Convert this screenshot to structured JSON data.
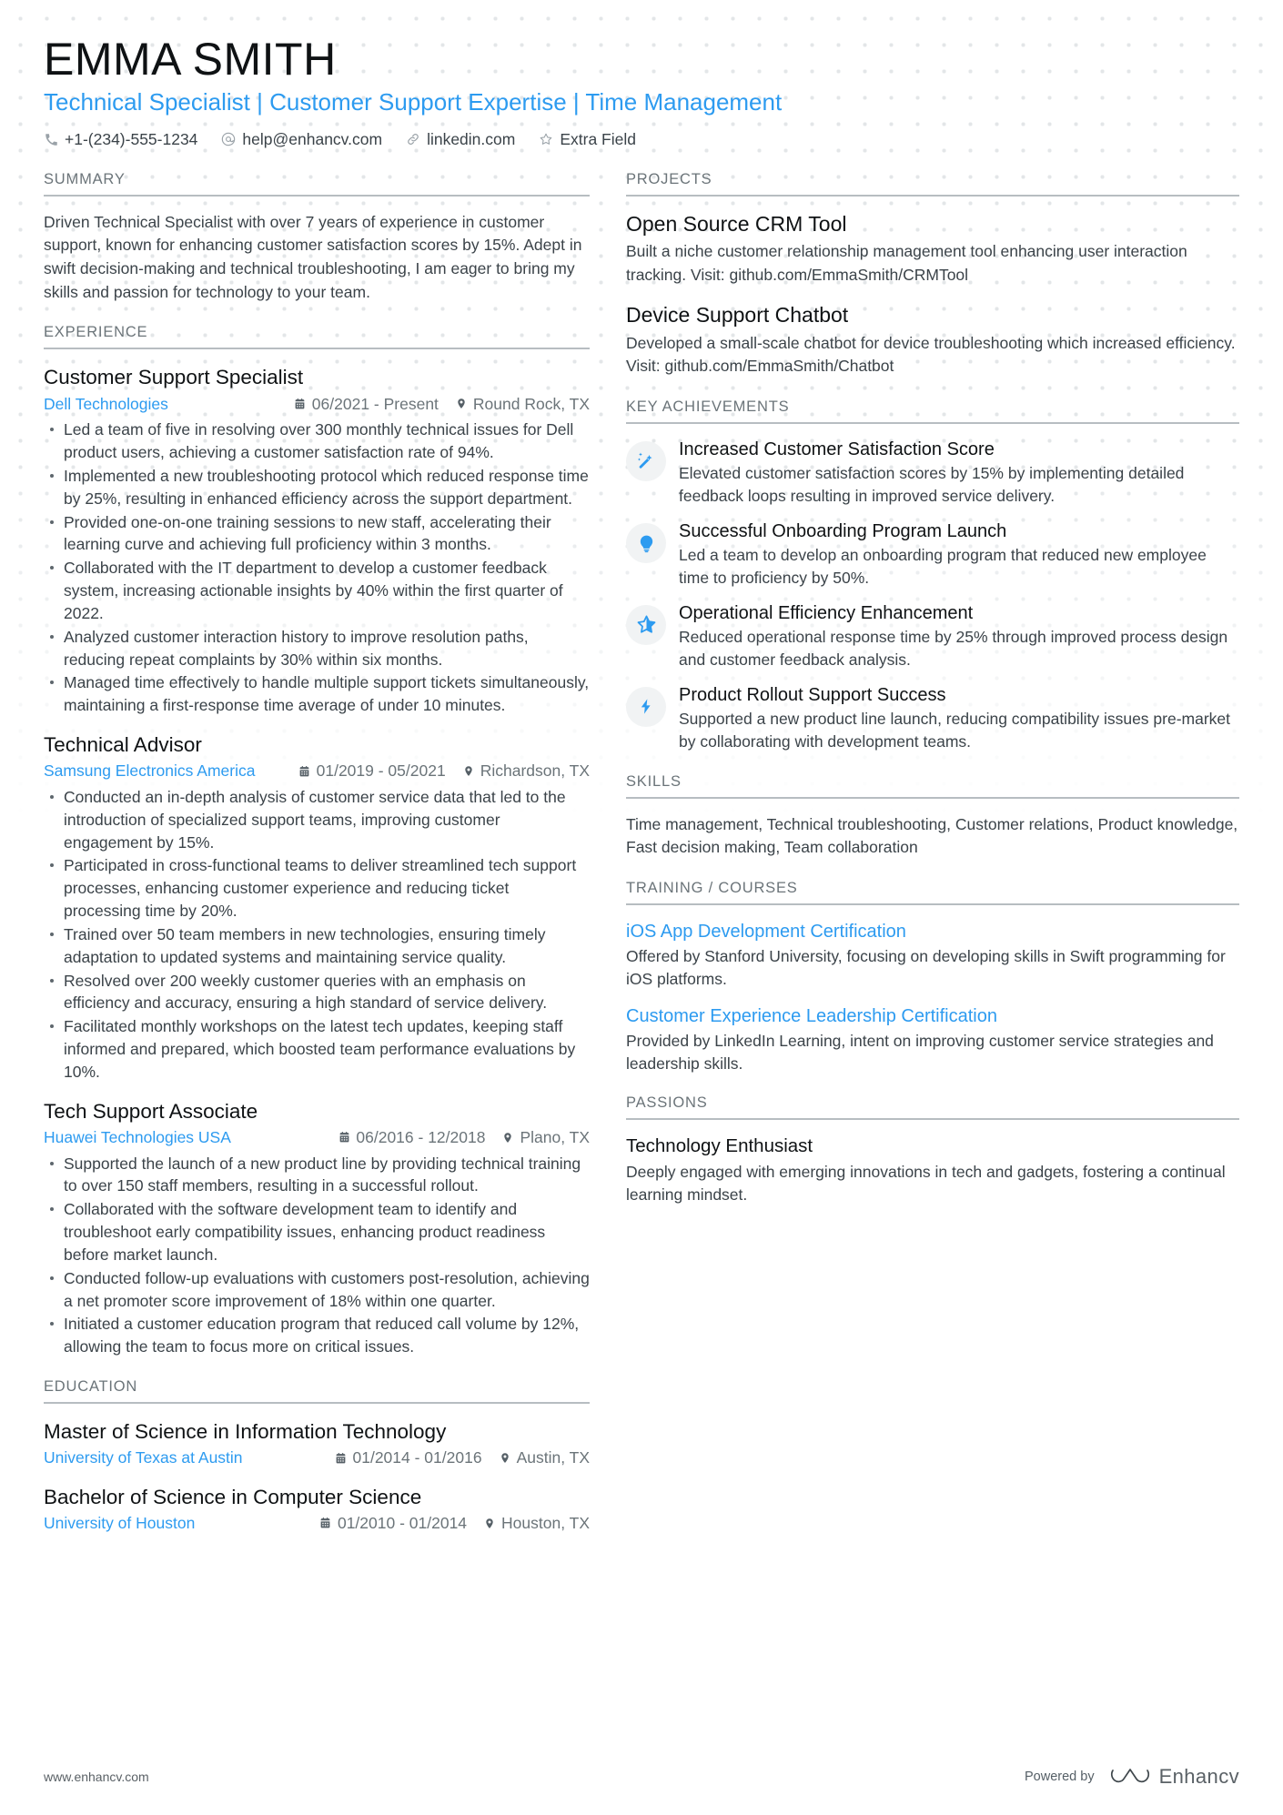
{
  "header": {
    "name": "EMMA SMITH",
    "headline": "Technical Specialist | Customer Support Expertise | Time Management",
    "contacts": [
      {
        "icon": "phone-icon",
        "text": "+1-(234)-555-1234"
      },
      {
        "icon": "email-icon",
        "text": "help@enhancv.com"
      },
      {
        "icon": "link-icon",
        "text": "linkedin.com"
      },
      {
        "icon": "star-icon",
        "text": "Extra Field"
      }
    ]
  },
  "left": {
    "summary": {
      "heading": "SUMMARY",
      "text": "Driven Technical Specialist with over 7 years of experience in customer support, known for enhancing customer satisfaction scores by 15%. Adept in swift decision-making and technical troubleshooting, I am eager to bring my skills and passion for technology to your team."
    },
    "experience": {
      "heading": "EXPERIENCE",
      "entries": [
        {
          "title": "Customer Support Specialist",
          "org": "Dell Technologies",
          "dates": "06/2021 - Present",
          "location": "Round Rock, TX",
          "bullets": [
            "Led a team of five in resolving over 300 monthly technical issues for Dell product users, achieving a customer satisfaction rate of 94%.",
            "Implemented a new troubleshooting protocol which reduced response time by 25%, resulting in enhanced efficiency across the support department.",
            "Provided one-on-one training sessions to new staff, accelerating their learning curve and achieving full proficiency within 3 months.",
            "Collaborated with the IT department to develop a customer feedback system, increasing actionable insights by 40% within the first quarter of 2022.",
            "Analyzed customer interaction history to improve resolution paths, reducing repeat complaints by 30% within six months.",
            "Managed time effectively to handle multiple support tickets simultaneously, maintaining a first-response time average of under 10 minutes."
          ]
        },
        {
          "title": "Technical Advisor",
          "org": "Samsung Electronics America",
          "dates": "01/2019 - 05/2021",
          "location": "Richardson, TX",
          "bullets": [
            "Conducted an in-depth analysis of customer service data that led to the introduction of specialized support teams, improving customer engagement by 15%.",
            "Participated in cross-functional teams to deliver streamlined tech support processes, enhancing customer experience and reducing ticket processing time by 20%.",
            "Trained over 50 team members in new technologies, ensuring timely adaptation to updated systems and maintaining service quality.",
            "Resolved over 200 weekly customer queries with an emphasis on efficiency and accuracy, ensuring a high standard of service delivery.",
            "Facilitated monthly workshops on the latest tech updates, keeping staff informed and prepared, which boosted team performance evaluations by 10%."
          ]
        },
        {
          "title": "Tech Support Associate",
          "org": "Huawei Technologies USA",
          "dates": "06/2016 - 12/2018",
          "location": "Plano, TX",
          "bullets": [
            "Supported the launch of a new product line by providing technical training to over 150 staff members, resulting in a successful rollout.",
            "Collaborated with the software development team to identify and troubleshoot early compatibility issues, enhancing product readiness before market launch.",
            "Conducted follow-up evaluations with customers post-resolution, achieving a net promoter score improvement of 18% within one quarter.",
            "Initiated a customer education program that reduced call volume by 12%, allowing the team to focus more on critical issues."
          ]
        }
      ]
    },
    "education": {
      "heading": "EDUCATION",
      "entries": [
        {
          "title": "Master of Science in Information Technology",
          "org": "University of Texas at Austin",
          "dates": "01/2014 - 01/2016",
          "location": "Austin, TX"
        },
        {
          "title": "Bachelor of Science in Computer Science",
          "org": "University of Houston",
          "dates": "01/2010 - 01/2014",
          "location": "Houston, TX"
        }
      ]
    }
  },
  "right": {
    "projects": {
      "heading": "PROJECTS",
      "items": [
        {
          "title": "Open Source CRM Tool",
          "desc": "Built a niche customer relationship management tool enhancing user interaction tracking. Visit: github.com/EmmaSmith/CRMTool"
        },
        {
          "title": "Device Support Chatbot",
          "desc": "Developed a small-scale chatbot for device troubleshooting which increased efficiency. Visit: github.com/EmmaSmith/Chatbot"
        }
      ]
    },
    "achievements": {
      "heading": "KEY ACHIEVEMENTS",
      "items": [
        {
          "icon": "magic-wand-icon",
          "title": "Increased Customer Satisfaction Score",
          "desc": "Elevated customer satisfaction scores by 15% by implementing detailed feedback loops resulting in improved service delivery."
        },
        {
          "icon": "lightbulb-icon",
          "title": "Successful Onboarding Program Launch",
          "desc": "Led a team to develop an onboarding program that reduced new employee time to proficiency by 50%."
        },
        {
          "icon": "star-badge-icon",
          "title": "Operational Efficiency Enhancement",
          "desc": "Reduced operational response time by 25% through improved process design and customer feedback analysis."
        },
        {
          "icon": "lightning-bolt-icon",
          "title": "Product Rollout Support Success",
          "desc": "Supported a new product line launch, reducing compatibility issues pre-market by collaborating with development teams."
        }
      ]
    },
    "skills": {
      "heading": "SKILLS",
      "text": "Time management, Technical troubleshooting, Customer relations, Product knowledge, Fast decision making, Team collaboration"
    },
    "training": {
      "heading": "TRAINING / COURSES",
      "items": [
        {
          "title": "iOS App Development Certification",
          "desc": "Offered by Stanford University, focusing on developing skills in Swift programming for iOS platforms."
        },
        {
          "title": "Customer Experience Leadership Certification",
          "desc": "Provided by LinkedIn Learning, intent on improving customer service strategies and leadership skills."
        }
      ]
    },
    "passions": {
      "heading": "PASSIONS",
      "items": [
        {
          "title": "Technology Enthusiast",
          "desc": "Deeply engaged with emerging innovations in tech and gadgets, fostering a continual learning mindset."
        }
      ]
    }
  },
  "footer": {
    "website": "www.enhancv.com",
    "powered_by": "Powered by",
    "brand": "Enhancv"
  },
  "colors": {
    "accent": "#2d9bf0",
    "heading": "#0f1214",
    "body": "#3b4349",
    "muted": "#6b7479",
    "rule": "#b7bdc1"
  }
}
